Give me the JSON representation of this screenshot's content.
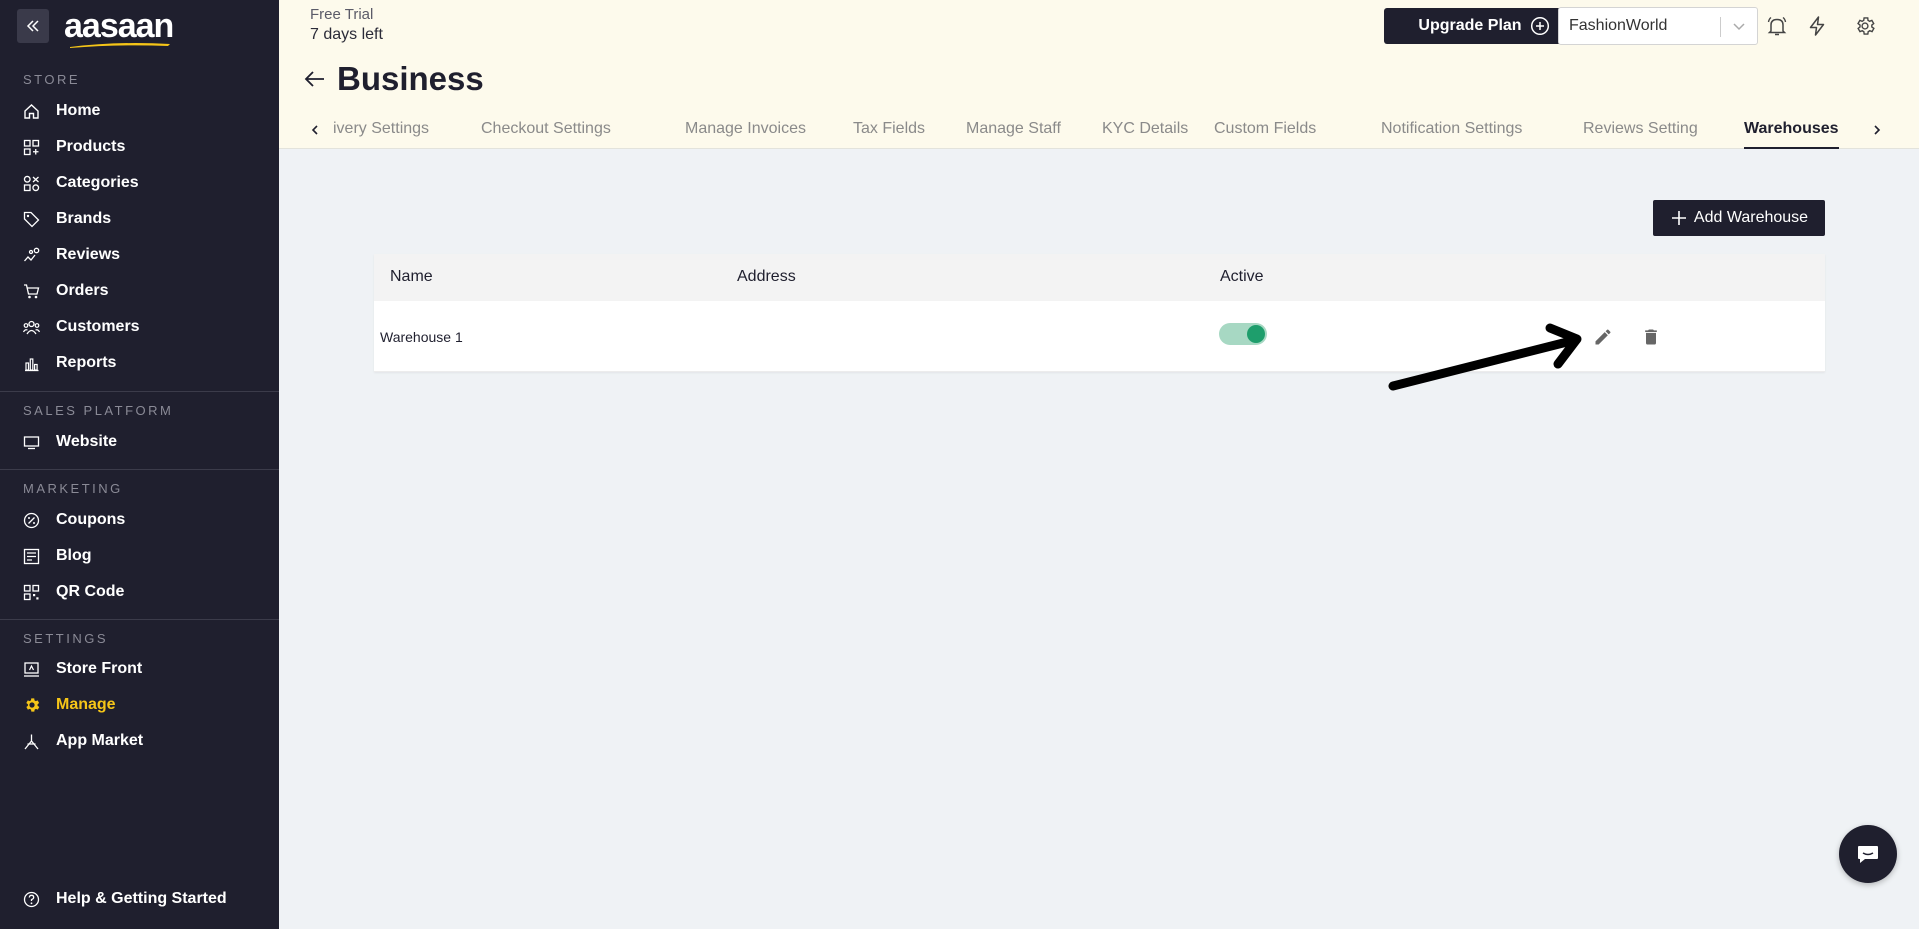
{
  "sidebar": {
    "logo": "aasaan",
    "sections": [
      {
        "label": "STORE",
        "items": [
          {
            "label": "Home",
            "icon": "home-icon"
          },
          {
            "label": "Products",
            "icon": "products-icon"
          },
          {
            "label": "Categories",
            "icon": "categories-icon"
          },
          {
            "label": "Brands",
            "icon": "tag-icon"
          },
          {
            "label": "Reviews",
            "icon": "reviews-icon"
          },
          {
            "label": "Orders",
            "icon": "cart-icon"
          },
          {
            "label": "Customers",
            "icon": "customers-icon"
          },
          {
            "label": "Reports",
            "icon": "reports-icon"
          }
        ]
      },
      {
        "label": "SALES PLATFORM",
        "items": [
          {
            "label": "Website",
            "icon": "monitor-icon"
          }
        ]
      },
      {
        "label": "MARKETING",
        "items": [
          {
            "label": "Coupons",
            "icon": "coupon-icon"
          },
          {
            "label": "Blog",
            "icon": "blog-icon"
          },
          {
            "label": "QR Code",
            "icon": "qr-code-icon"
          }
        ]
      },
      {
        "label": "SETTINGS",
        "items": [
          {
            "label": "Store Front",
            "icon": "store-front-icon"
          },
          {
            "label": "Manage",
            "icon": "gear-icon"
          },
          {
            "label": "App Market",
            "icon": "app-market-icon"
          }
        ]
      }
    ],
    "help_label": "Help & Getting Started"
  },
  "header": {
    "trial_label": "Free Trial",
    "trial_days": "7 days left",
    "upgrade_label": "Upgrade Plan",
    "store_name": "FashionWorld",
    "page_title": "Business",
    "tabs": [
      "ivery Settings",
      "Checkout Settings",
      "Manage Invoices",
      "Tax Fields",
      "Manage Staff",
      "KYC Details",
      "Custom Fields",
      "Notification Settings",
      "Reviews Setting",
      "Warehouses"
    ],
    "active_tab": "Warehouses"
  },
  "main": {
    "add_button_label": "Add Warehouse",
    "table": {
      "columns": [
        "Name",
        "Address",
        "Active"
      ],
      "rows": [
        {
          "name": "Warehouse 1",
          "address": "",
          "active": true
        }
      ]
    }
  },
  "colors": {
    "sidebar_bg": "#1f1f2e",
    "active_accent": "#f5c518",
    "topbar_bg": "#fdfaec",
    "toggle_on": "#1e9e6c"
  }
}
